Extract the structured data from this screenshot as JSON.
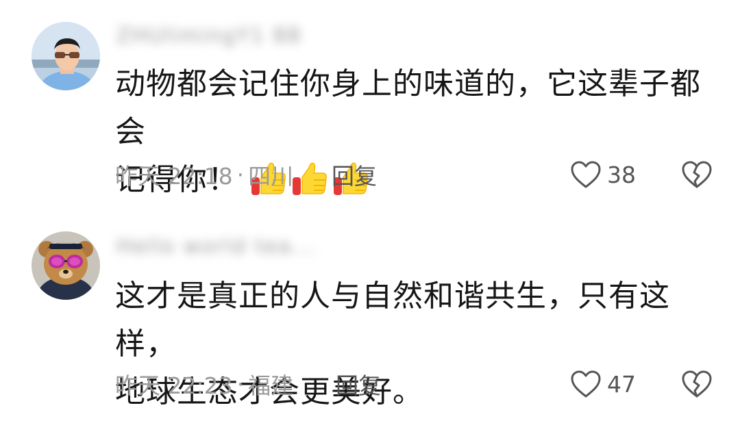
{
  "comments": [
    {
      "username": "ZHUlimingY1 88",
      "avatar": "person-avatar",
      "text_line1": "动物都会记住你身上的味道的，它这辈子都会",
      "text_line2": "记得你！",
      "emoji": [
        "thumbs-up-icon",
        "thumbs-up-icon",
        "thumbs-up-icon"
      ],
      "time": "昨天 22:18",
      "separator": "·",
      "location": "四川",
      "reply_label": "回复",
      "like_count": "38"
    },
    {
      "username": "Hello world tea...",
      "avatar": "teddy-bear-avatar",
      "text_line1": "这才是真正的人与自然和谐共生，只有这样，",
      "text_line2": "地球生态才会更美好。",
      "time": "昨天 22:23",
      "separator": "·",
      "location": "福建",
      "reply_label": "回复",
      "like_count": "47"
    }
  ],
  "colors": {
    "text": "#161616",
    "meta": "#9a9a9a",
    "action": "#555555",
    "thumb_yellow": "#FDD835",
    "thumb_red": "#E53935"
  }
}
